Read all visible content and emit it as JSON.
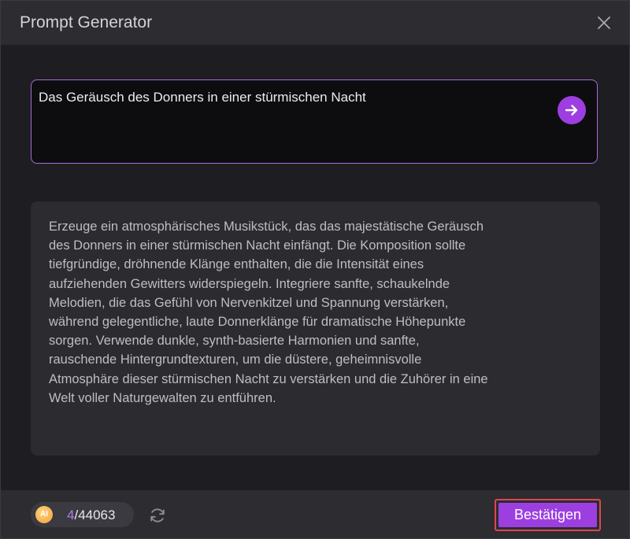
{
  "dialog": {
    "title": "Prompt Generator"
  },
  "prompt": {
    "value": "Das Geräusch des Donners in einer stürmischen Nacht"
  },
  "result": {
    "text": "Erzeuge ein atmosphärisches Musikstück, das das majestätische Geräusch\ndes Donners in einer stürmischen Nacht einfängt. Die Komposition sollte\ntiefgründige, dröhnende Klänge enthalten, die die Intensität eines\naufziehenden Gewitters widerspiegeln. Integriere sanfte, schaukelnde\nMelodien, die das Gefühl von Nervenkitzel und Spannung verstärken,\nwährend gelegentliche, laute Donnerklänge für dramatische Höhepunkte\nsorgen. Verwende dunkle, synth-basierte Harmonien und sanfte,\nrauschende Hintergrundtexturen, um die düstere, geheimnisvolle\nAtmosphäre dieser stürmischen Nacht zu verstärken und die Zuhörer in eine\nWelt voller Naturgewalten zu entführen."
  },
  "footer": {
    "coin_label": "AI",
    "credits_used": "4",
    "credits_total": "/44063",
    "confirm_label": "Bestätigen"
  },
  "icons": {
    "close": "close-icon",
    "send": "arrow-right-icon",
    "refresh": "refresh-icon",
    "coin": "ai-coin-icon"
  },
  "colors": {
    "accent": "#9d3fe0",
    "accent_border": "#a86ad8",
    "highlight_border": "#e0454f",
    "credits_used": "#b679f0"
  }
}
